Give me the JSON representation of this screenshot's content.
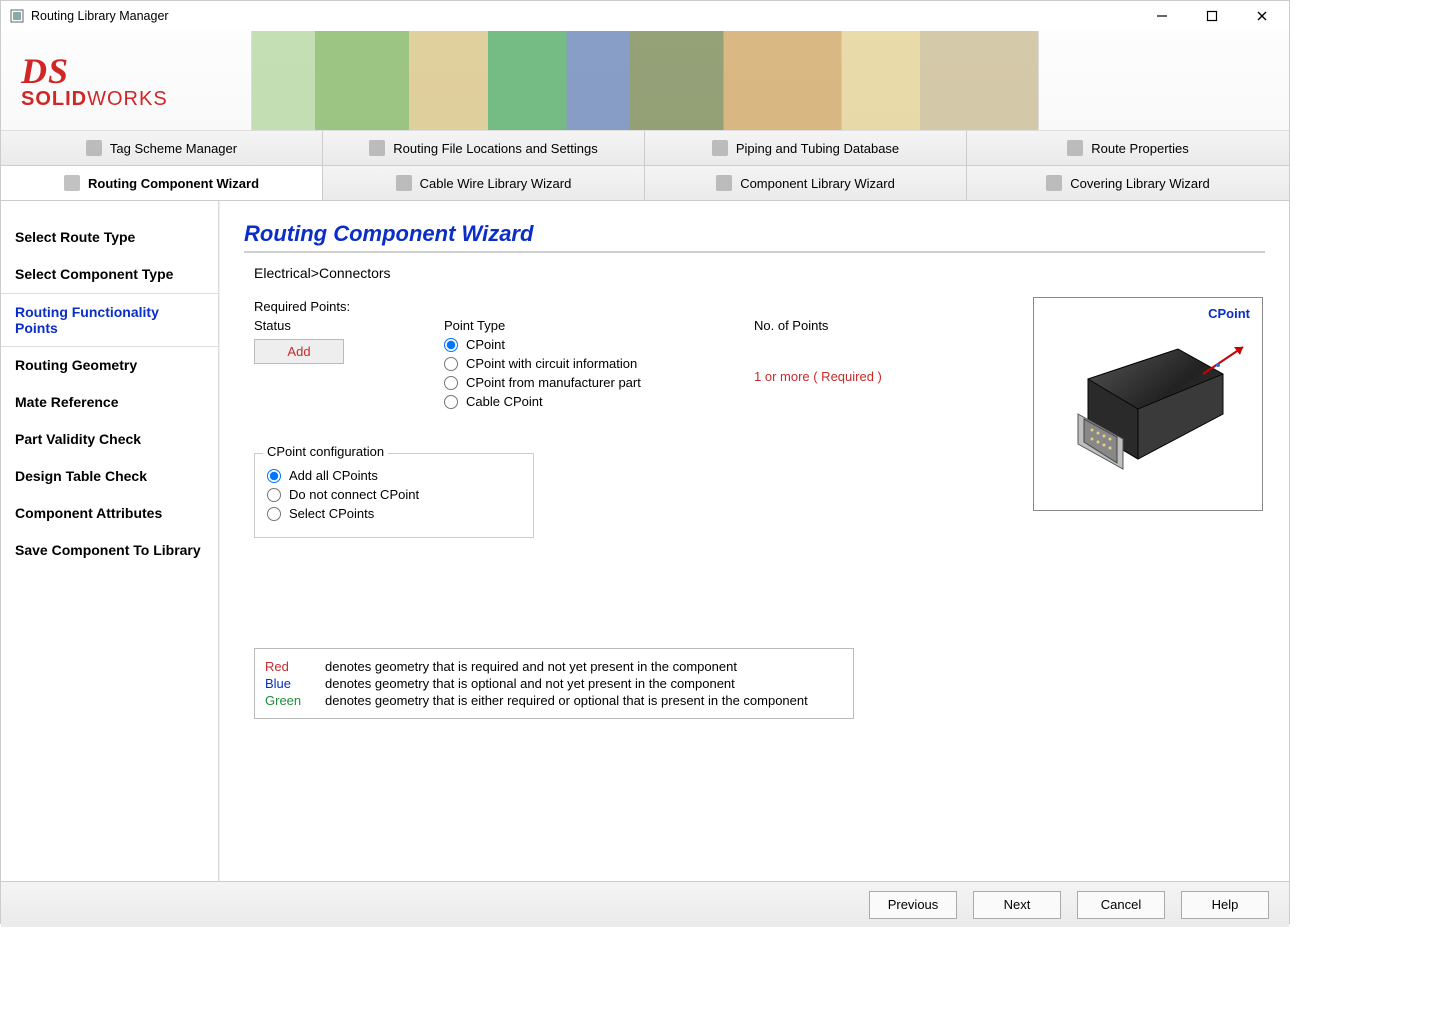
{
  "window": {
    "title": "Routing Library Manager"
  },
  "logo": {
    "ds": "DS",
    "solid": "SOLID",
    "works": "WORKS"
  },
  "tabs_row1": [
    {
      "label": "Tag Scheme Manager"
    },
    {
      "label": "Routing File Locations and Settings"
    },
    {
      "label": "Piping and Tubing Database"
    },
    {
      "label": "Route Properties"
    }
  ],
  "tabs_row2": [
    {
      "label": "Routing Component Wizard",
      "active": true
    },
    {
      "label": "Cable Wire Library Wizard"
    },
    {
      "label": "Component Library Wizard"
    },
    {
      "label": "Covering Library Wizard"
    }
  ],
  "sidebar_steps": [
    "Select Route Type",
    "Select Component Type",
    "Routing Functionality Points",
    "Routing Geometry",
    "Mate Reference",
    "Part Validity Check",
    "Design Table Check",
    "Component Attributes",
    "Save Component To Library"
  ],
  "sidebar_active_index": 2,
  "content": {
    "title": "Routing Component Wizard",
    "breadcrumb": "Electrical>Connectors",
    "required_points_label": "Required Points:",
    "status_label": "Status",
    "point_type_label": "Point Type",
    "no_points_label": "No. of Points",
    "add_button": "Add",
    "point_type_options": [
      "CPoint",
      "CPoint with circuit information",
      "CPoint from manufacturer part",
      "Cable CPoint"
    ],
    "point_type_selected": 0,
    "required_text": "1 or more ( Required )",
    "cpoint_config_legend": "CPoint configuration",
    "cpoint_config_options": [
      "Add all CPoints",
      "Do not connect CPoint",
      "Select CPoints"
    ],
    "cpoint_config_selected": 0,
    "preview_label": "CPoint",
    "legend": {
      "red_label": "Red",
      "red_desc": "denotes geometry that is required and not yet present in the component",
      "blue_label": "Blue",
      "blue_desc": "denotes geometry that is optional and not yet present in the component",
      "green_label": "Green",
      "green_desc": "denotes geometry that is either required or optional that is present in the component"
    }
  },
  "footer": {
    "previous": "Previous",
    "next": "Next",
    "cancel": "Cancel",
    "help": "Help"
  }
}
